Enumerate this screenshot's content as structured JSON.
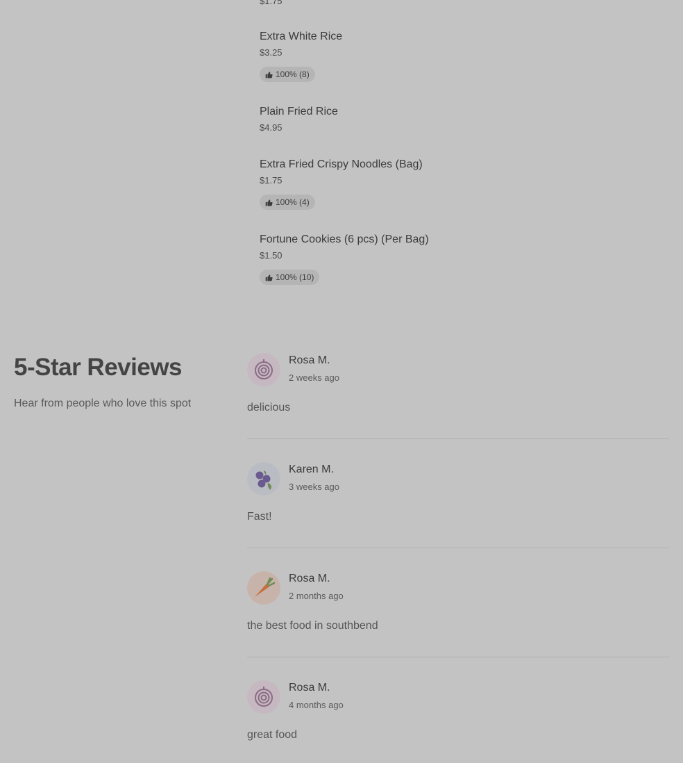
{
  "menu": {
    "cut_price": "$1.75",
    "items": [
      {
        "name": "Extra White Rice",
        "price": "$3.25",
        "rating": "100% (8)"
      },
      {
        "name": "Plain Fried Rice",
        "price": "$4.95"
      },
      {
        "name": "Extra Fried Crispy Noodles (Bag)",
        "price": "$1.75",
        "rating": "100% (4)"
      },
      {
        "name": "Fortune Cookies (6 pcs) (Per Bag)",
        "price": "$1.50",
        "rating": "100% (10)"
      }
    ]
  },
  "reviews": {
    "title": "5-Star Reviews",
    "subtitle": "Hear from people who love this spot",
    "items": [
      {
        "name": "Rosa M.",
        "time": "2 weeks ago",
        "text": "delicious",
        "avatar": "onion-icon"
      },
      {
        "name": "Karen M.",
        "time": "3 weeks ago",
        "text": "Fast!",
        "avatar": "blueberry-icon"
      },
      {
        "name": "Rosa M.",
        "time": "2 months ago",
        "text": "the best food in southbend",
        "avatar": "carrot-icon"
      },
      {
        "name": "Rosa M.",
        "time": "4 months ago",
        "text": "great food",
        "avatar": "onion-icon"
      }
    ]
  },
  "colors": {
    "overlay_bg": "#c3c3c3",
    "rating_pill": "#b5b5b5",
    "onion_avatar_bg": "#c6b8c0",
    "blueberry_avatar_bg": "#b9bcc2",
    "carrot_avatar_bg": "#c8b3aa"
  }
}
